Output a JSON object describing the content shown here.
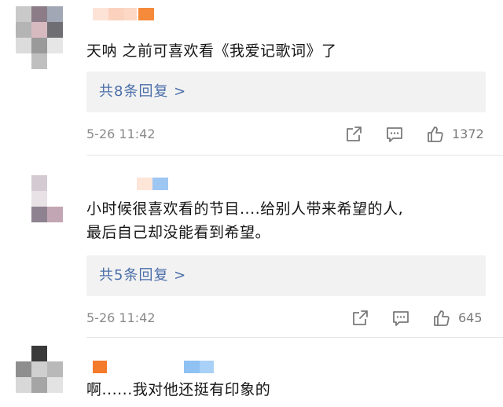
{
  "colors": {
    "reply_link": "#4a6ea9",
    "meta_text": "#8a8a8a",
    "reply_bg": "#f2f2f2"
  },
  "comments": [
    {
      "text": "天呐 之前可喜欢看《我爱记歌词》了",
      "replies_label": "共8条回复 >",
      "time": "5-26 11:42",
      "likes": "1372",
      "icons": [
        "share-icon",
        "comment-icon",
        "like-icon"
      ]
    },
    {
      "text_lines": [
        "小时候很喜欢看的节目....给别人带来希望的人,",
        "最后自己却没能看到希望。"
      ],
      "replies_label": "共5条回复 >",
      "time": "5-26 11:42",
      "likes": "645",
      "icons": [
        "share-icon",
        "comment-icon",
        "like-icon"
      ]
    },
    {
      "text": "啊......我对他还挺有印象的"
    }
  ]
}
